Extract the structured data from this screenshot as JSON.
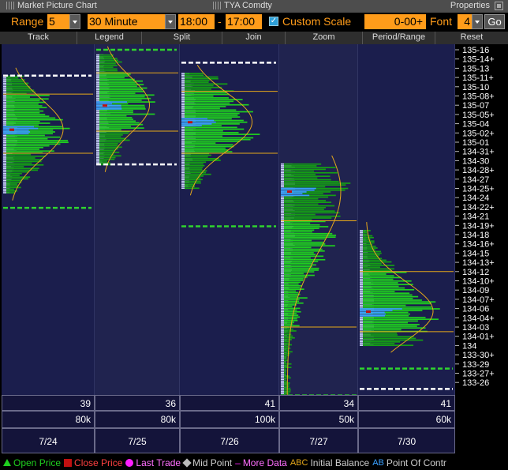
{
  "window": {
    "title": "Market Picture Chart",
    "security": "TYA Comdty",
    "properties": "Properties"
  },
  "controls": {
    "range_label": "Range",
    "range_value": "5",
    "interval_value": "30 Minute",
    "start_time": "18:00",
    "separator": "-",
    "end_time": "17:00",
    "custom_scale_label": "Custom Scale",
    "custom_scale_checked": true,
    "scale_value": "0-00+",
    "font_label": "Font",
    "font_value": "4",
    "go_label": "Go"
  },
  "toolbar": {
    "items": [
      "Track",
      "Legend",
      "Split",
      "Join",
      "Zoom",
      "Period/Range",
      "Reset"
    ]
  },
  "colors": {
    "background": "#000000",
    "panel": "#1a1d4a",
    "accent_orange": "#ff9c1a",
    "tpo_green": "#1fd01f",
    "value_area_blue": "#3aa0ff",
    "poc_red": "#c01010",
    "curve_gold": "#e6a81a"
  },
  "axis": {
    "labels": [
      "135-16",
      "135-14+",
      "135-13",
      "135-11+",
      "135-10",
      "135-08+",
      "135-07",
      "135-05+",
      "135-04",
      "135-02+",
      "135-01",
      "134-31+",
      "134-30",
      "134-28+",
      "134-27",
      "134-25+",
      "134-24",
      "134-22+",
      "134-21",
      "134-19+",
      "134-18",
      "134-16+",
      "134-15",
      "134-13+",
      "134-12",
      "134-10+",
      "134-09",
      "134-07+",
      "134-06",
      "134-04+",
      "134-03",
      "134-01+",
      "134",
      "133-30+",
      "133-29",
      "133-27+",
      "133-26"
    ]
  },
  "sessions": [
    {
      "date": "7/24",
      "count": "39",
      "volume": "80k"
    },
    {
      "date": "7/25",
      "count": "36",
      "volume": "80k"
    },
    {
      "date": "7/26",
      "count": "41",
      "volume": "100k"
    },
    {
      "date": "7/27",
      "count": "34",
      "volume": "50k"
    },
    {
      "date": "7/30",
      "count": "41",
      "volume": "60k"
    }
  ],
  "legend": {
    "open_price": "Open Price",
    "close_price": "Close Price",
    "last_trade": "Last Trade",
    "mid_point": "Mid Point",
    "more_data": "More Data",
    "abc": "ABC",
    "initial_balance": "Initial Balance",
    "ab": "AB",
    "point_of_control": "Point Of Contr"
  }
}
